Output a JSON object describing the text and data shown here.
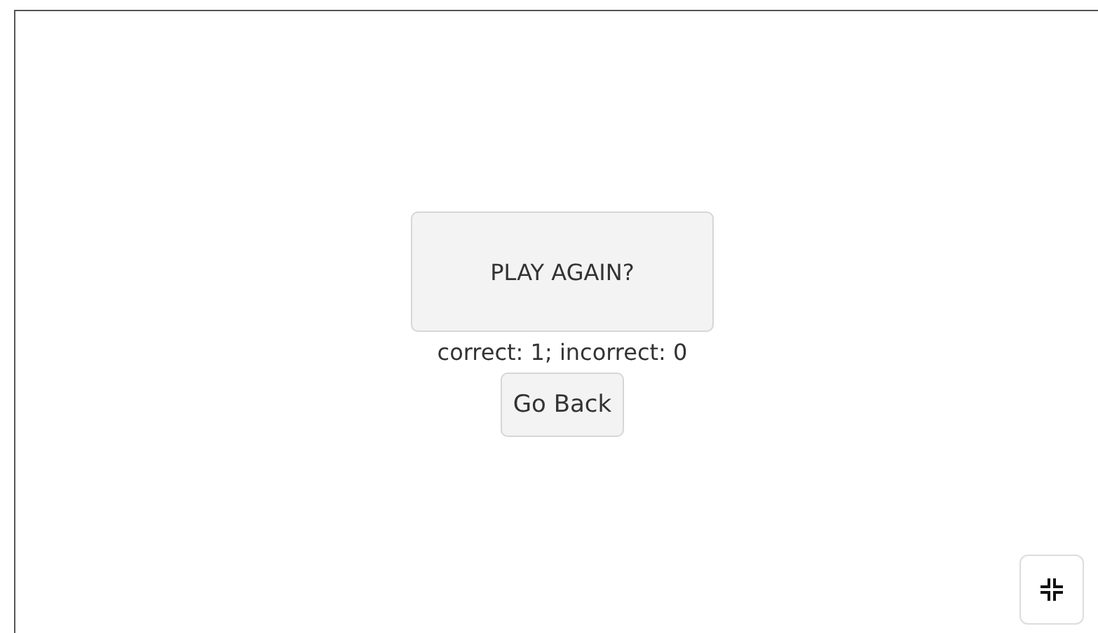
{
  "play_again_button": {
    "label": "PLAY AGAIN?"
  },
  "score": "correct: 1; incorrect: 0",
  "go_back_button": {
    "label": "Go Back"
  },
  "fullscreen_button": {
    "kind": "exit"
  }
}
